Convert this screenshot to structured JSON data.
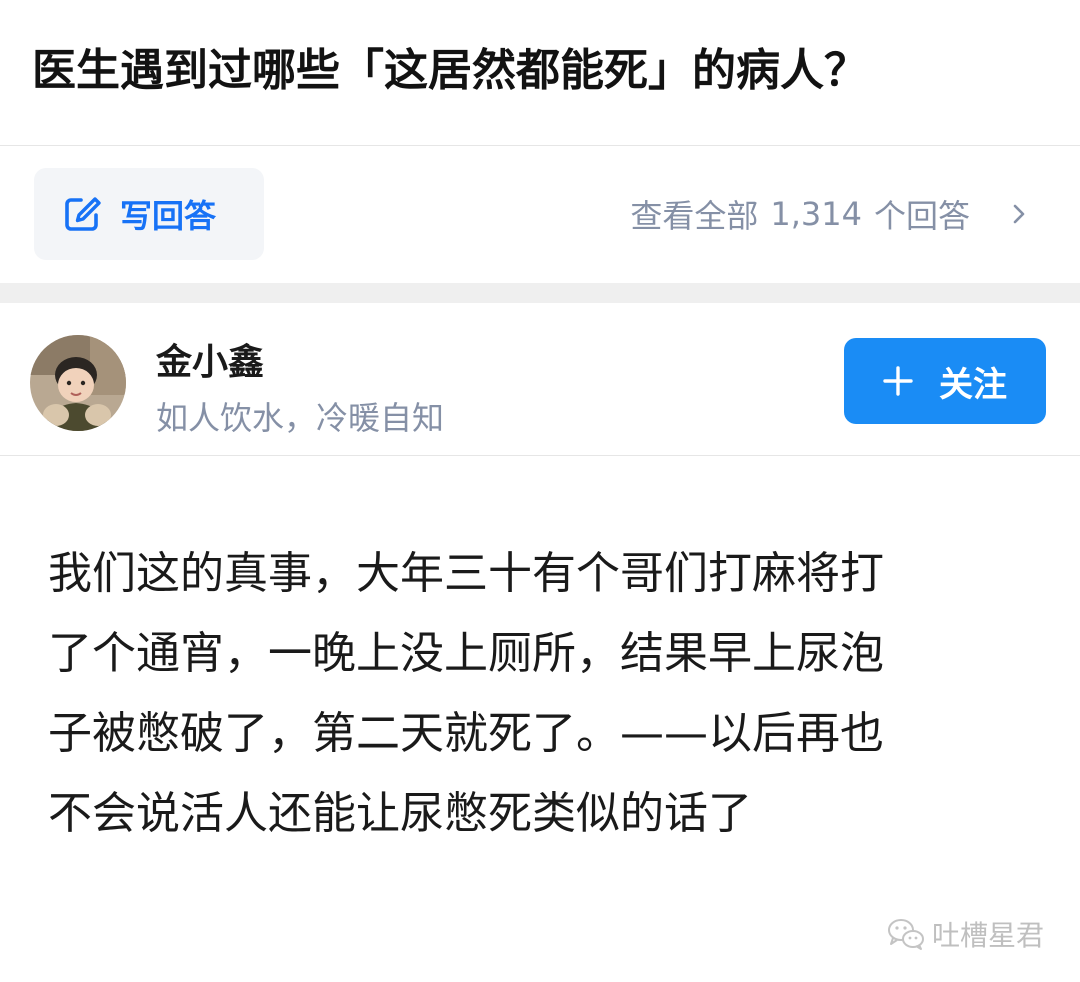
{
  "question": {
    "title": "医生遇到过哪些「这居然都能死」的病人？"
  },
  "action_bar": {
    "write_answer_label": "写回答",
    "view_all_prefix": "查看全部",
    "answer_count": "1,314",
    "view_all_suffix": "个回答"
  },
  "author": {
    "name": "金小鑫",
    "bio": "如人饮水，冷暖自知",
    "follow_label": "关注"
  },
  "answer": {
    "lines": [
      "我们这的真事，大年三十有个哥们打麻将打",
      "了个通宵，一晚上没上厕所，结果早上尿泡",
      "子被憋破了，第二天就死了。——以后再也",
      "不会说活人还能让尿憋死类似的话了"
    ]
  },
  "watermark": {
    "text": "吐槽星君"
  },
  "colors": {
    "accent": "#1772f6",
    "follow_button": "#1a8cf5",
    "muted_text": "#8590a6",
    "divider": "#e6e6e6",
    "band": "#efefef"
  },
  "icons": {
    "write": "pencil-square-icon",
    "chevron": "chevron-right-icon",
    "plus": "plus-icon",
    "watermark": "wechat-icon"
  }
}
